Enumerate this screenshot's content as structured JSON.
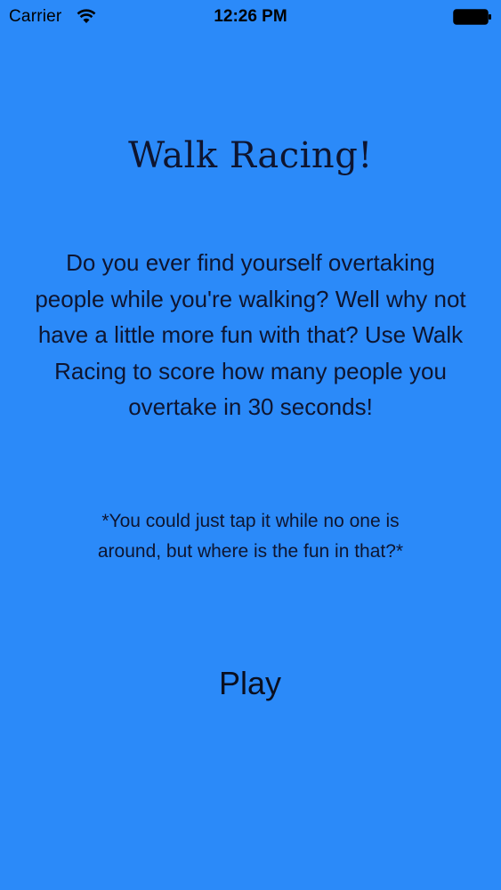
{
  "status_bar": {
    "carrier": "Carrier",
    "time": "12:26 PM",
    "wifi_icon": "wifi-icon",
    "battery_icon": "battery-icon"
  },
  "main": {
    "title": "Walk Racing!",
    "intro": "Do you ever find yourself overtaking people while you're walking? Well why not have a little more fun with that? Use Walk Racing to score how many people you overtake in 30 seconds!",
    "note": "*You could just tap it while no one is around, but where is the fun in that?*",
    "play_label": "Play"
  },
  "colors": {
    "background": "#2b8af9",
    "text": "#0e1530"
  }
}
